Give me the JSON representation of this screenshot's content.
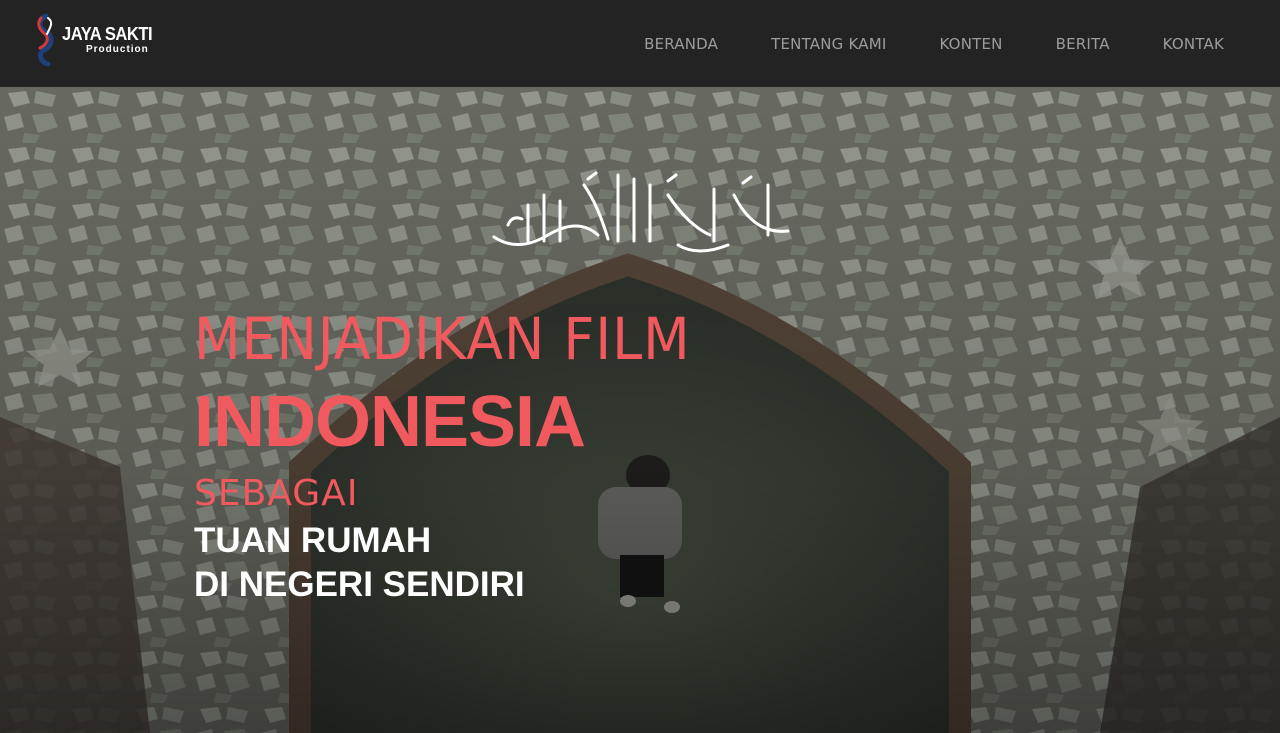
{
  "brand": {
    "name": "JAYA SAKTI",
    "sub": "Production"
  },
  "nav": {
    "items": [
      {
        "label": "BERANDA"
      },
      {
        "label": "TENTANG KAMI"
      },
      {
        "label": "KONTEN"
      },
      {
        "label": "BERITA"
      },
      {
        "label": "KONTAK"
      }
    ]
  },
  "hero": {
    "calligraphy": "بسم الله الرحمن الرحيم",
    "line1": "MENJADIKAN FILM",
    "line2": "INDONESIA",
    "line3": "SEBAGAI",
    "line4": "TUAN RUMAH",
    "line5": "DI NEGERI SENDIRI"
  },
  "colors": {
    "navbar": "#232323",
    "nav_text": "#9c9c9c",
    "accent": "#f05a5f",
    "headline_white": "#ffffff"
  }
}
